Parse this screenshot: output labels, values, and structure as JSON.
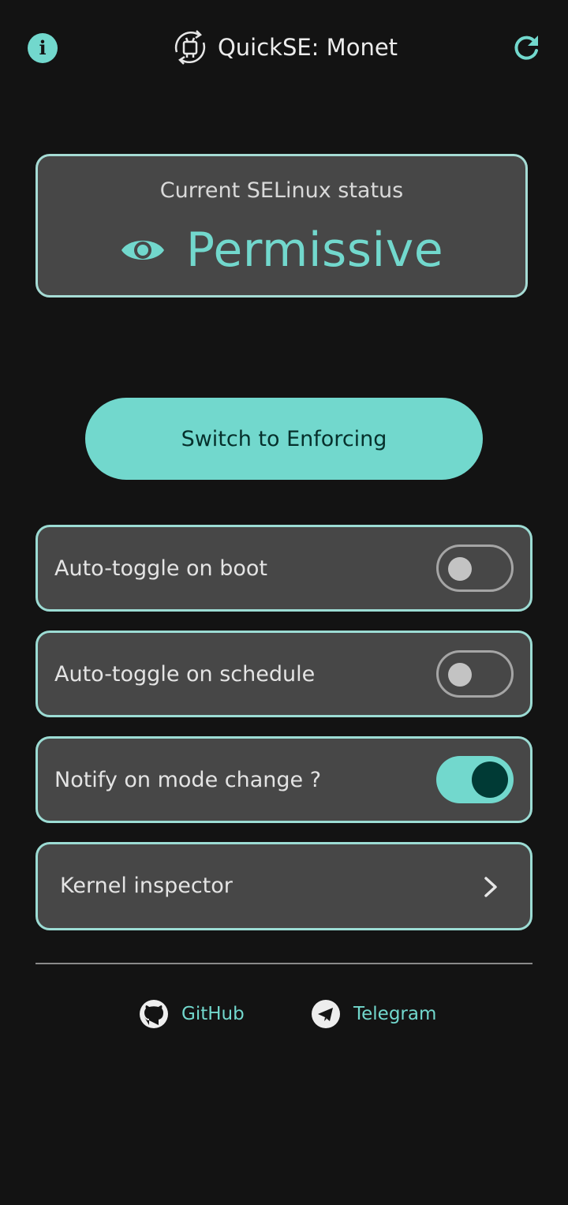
{
  "header": {
    "title": "QuickSE: Monet",
    "info_icon": "info-icon",
    "refresh_icon": "refresh-icon"
  },
  "status": {
    "label": "Current SELinux status",
    "value": "Permissive",
    "icon": "eye-icon"
  },
  "primary_action": {
    "label": "Switch to Enforcing"
  },
  "options": [
    {
      "label": "Auto-toggle on boot",
      "enabled": false
    },
    {
      "label": "Auto-toggle on schedule",
      "enabled": false
    },
    {
      "label": "Notify on mode change ?",
      "enabled": true
    }
  ],
  "nav": {
    "kernel_inspector": "Kernel inspector"
  },
  "links": [
    {
      "label": "GitHub",
      "icon": "github-icon"
    },
    {
      "label": "Telegram",
      "icon": "telegram-icon"
    }
  ],
  "colors": {
    "accent": "#72d8cd",
    "background": "#131313",
    "card": "#474747",
    "card_border": "#a6dcd5"
  }
}
